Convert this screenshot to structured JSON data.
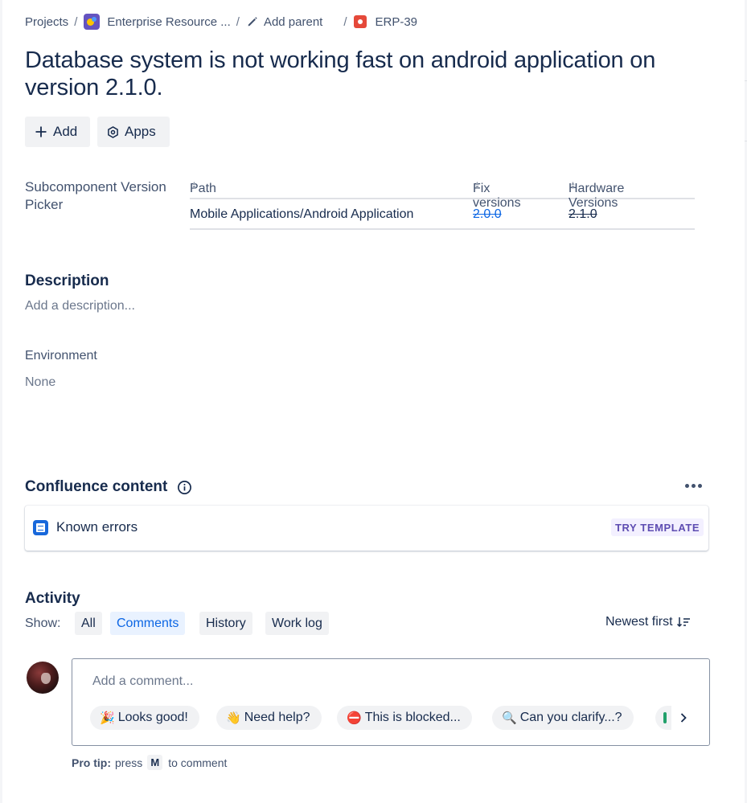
{
  "breadcrumb": {
    "projects": "Projects",
    "project_name": "Enterprise Resource ...",
    "add_parent": "Add parent",
    "issue_key": "ERP-39",
    "separator": "/"
  },
  "issue": {
    "title": "Database system is not working fast on android application on version 2.1.0."
  },
  "actions": {
    "add_label": "Add",
    "apps_label": "Apps"
  },
  "subcomponent": {
    "label": "Subcomponent Version Picker",
    "columns": [
      "Path",
      "Fix versions",
      "Hardware Versions"
    ],
    "rows": [
      {
        "path": "Mobile Applications/Android Application",
        "fix_version": "2.0.0",
        "hardware_version": "2.1.0"
      }
    ]
  },
  "description": {
    "heading": "Description",
    "placeholder": "Add a description..."
  },
  "environment": {
    "label": "Environment",
    "value": "None"
  },
  "confluence": {
    "heading": "Confluence content",
    "item_name": "Known errors",
    "template_label": "TRY TEMPLATE"
  },
  "activity": {
    "heading": "Activity",
    "show_label": "Show:",
    "filters": [
      "All",
      "Comments",
      "History",
      "Work log"
    ],
    "active_filter": "Comments",
    "sort_label": "Newest first"
  },
  "comment": {
    "placeholder": "Add a comment...",
    "quick_replies": [
      {
        "emoji": "🎉",
        "text": "Looks good!"
      },
      {
        "emoji": "👋",
        "text": "Need help?"
      },
      {
        "emoji": "⛔",
        "text": "This is blocked..."
      },
      {
        "emoji": "🔍",
        "text": "Can you clarify...?"
      }
    ],
    "pro_tip_label": "Pro tip:",
    "pro_tip_press": "press",
    "pro_tip_key": "M",
    "pro_tip_suffix": "to comment"
  },
  "colors": {
    "link_blue": "#0c66e4",
    "text_primary": "#172b4d",
    "text_subtle": "#42526e",
    "bug_red": "#e5493a",
    "template_purple": "#5e4db2"
  }
}
